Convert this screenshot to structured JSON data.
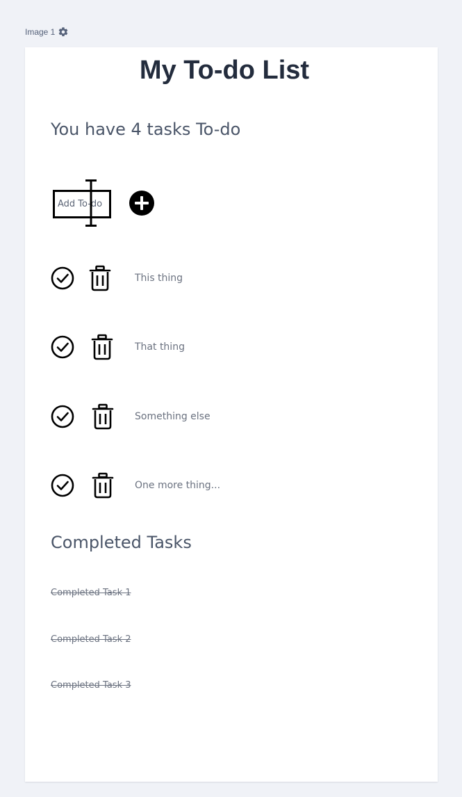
{
  "caption": {
    "label": "Image 1",
    "icon": "gear-icon"
  },
  "app": {
    "title": "My To-do List",
    "tasks_count_text": "You have 4 tasks To-do"
  },
  "add_form": {
    "placeholder": "Add To-do",
    "value": "",
    "add_icon": "plus-circle-icon"
  },
  "todos": [
    {
      "text": "This thing"
    },
    {
      "text": "That thing"
    },
    {
      "text": "Something else"
    },
    {
      "text": "One more thing..."
    }
  ],
  "row_icons": {
    "complete": "check-circle-icon",
    "delete": "trash-icon"
  },
  "completed": {
    "title": "Completed Tasks",
    "items": [
      {
        "text": "Completed Task 1"
      },
      {
        "text": "Completed Task 2"
      },
      {
        "text": "Completed Task 3"
      }
    ]
  },
  "colors": {
    "page_bg": "#f0f2f7",
    "card_bg": "#ffffff",
    "title": "#232c3d",
    "heading": "#4a5568",
    "muted": "#6b7280",
    "icon": "#000000"
  }
}
